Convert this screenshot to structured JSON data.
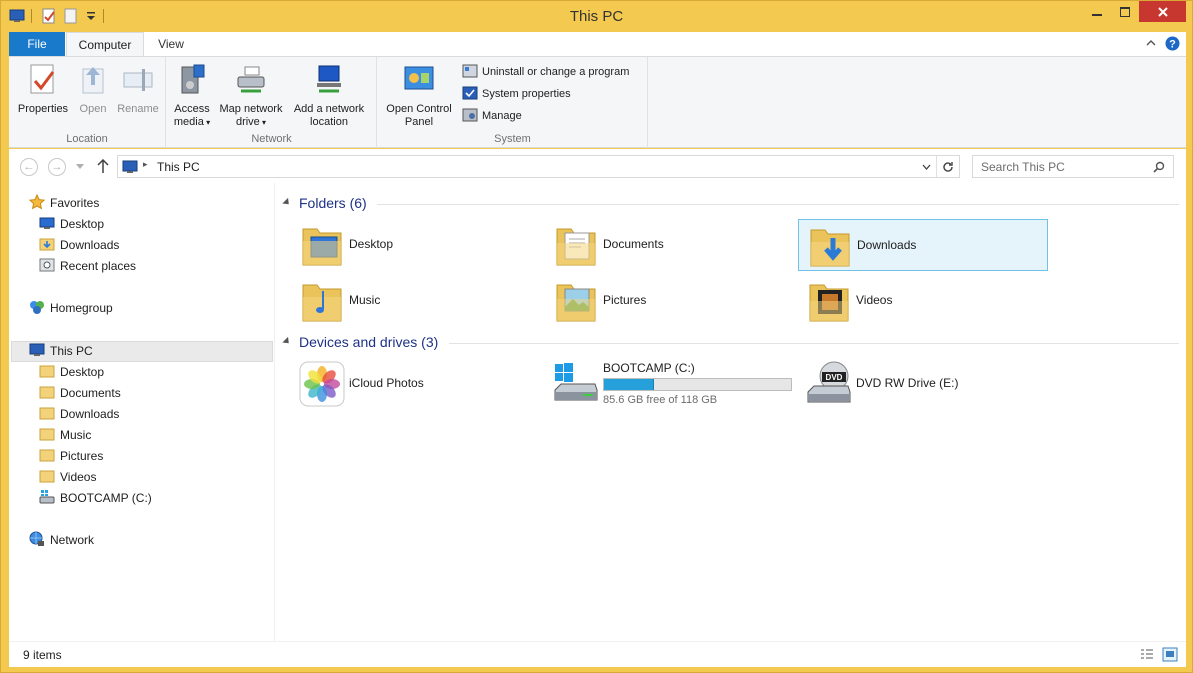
{
  "window": {
    "title": "This PC",
    "controls": [
      "minimize",
      "maximize",
      "close"
    ]
  },
  "ribbon": {
    "tabs": [
      "File",
      "Computer",
      "View"
    ],
    "location": {
      "label": "Location",
      "properties": "Properties",
      "open": "Open",
      "rename": "Rename"
    },
    "network": {
      "label": "Network",
      "access_media_1": "Access",
      "access_media_2": "media",
      "map_drive_1": "Map network",
      "map_drive_2": "drive",
      "add_location_1": "Add a network",
      "add_location_2": "location"
    },
    "system": {
      "label": "System",
      "control_panel_1": "Open Control",
      "control_panel_2": "Panel",
      "uninstall": "Uninstall or change a program",
      "system_properties": "System properties",
      "manage": "Manage"
    }
  },
  "address": {
    "path": "This PC",
    "search_placeholder": "Search This PC"
  },
  "nav": {
    "favorites": "Favorites",
    "fav_items": [
      "Desktop",
      "Downloads",
      "Recent places"
    ],
    "homegroup": "Homegroup",
    "this_pc": "This PC",
    "pc_items": [
      "Desktop",
      "Documents",
      "Downloads",
      "Music",
      "Pictures",
      "Videos",
      "BOOTCAMP (C:)"
    ],
    "network": "Network"
  },
  "content": {
    "folders_header": "Folders (6)",
    "folders": [
      "Desktop",
      "Documents",
      "Downloads",
      "Music",
      "Pictures",
      "Videos"
    ],
    "selected_folder": "Downloads",
    "devices_header": "Devices and drives (3)",
    "devices": {
      "icloud": "iCloud Photos",
      "bootcamp": "BOOTCAMP (C:)",
      "bootcamp_free": "85.6 GB free of 118 GB",
      "bootcamp_used_fraction": 0.27,
      "dvd": "DVD RW Drive (E:)"
    }
  },
  "status": {
    "items": "9 items"
  },
  "colors": {
    "frame": "#f3c94f",
    "file_tab": "#1979ca",
    "section_header": "#1e3287",
    "selection": "#e5f3fb",
    "close": "#c7372f",
    "drive_bar": "#26a0da"
  }
}
